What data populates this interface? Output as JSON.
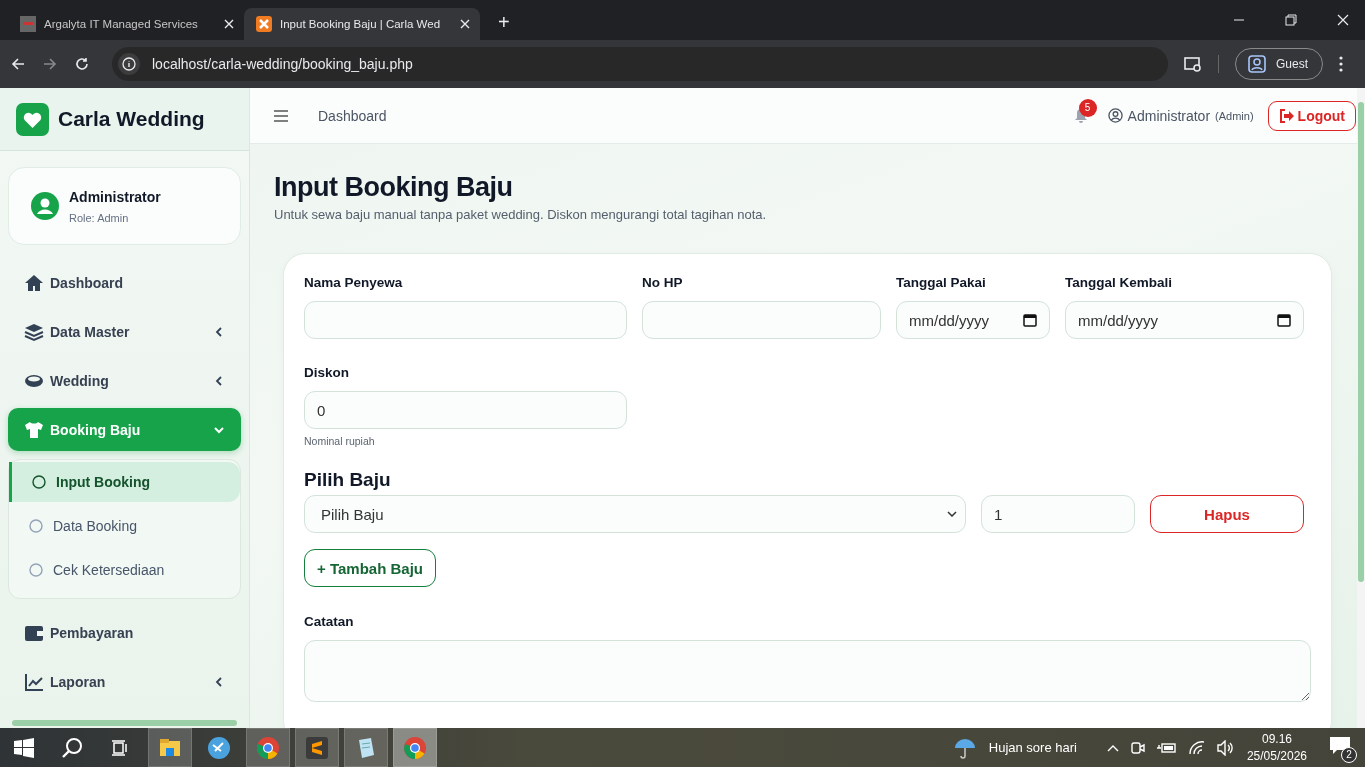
{
  "browser": {
    "tabs": [
      {
        "title": "Argalyta IT Managed Services",
        "selected": false
      },
      {
        "title": "Input Booking Baju | Carla Wed",
        "selected": true
      }
    ],
    "new_tab": "+",
    "address": "localhost/carla-wedding/booking_baju.php",
    "profile": "Guest"
  },
  "sidebar": {
    "brand": "Carla Wedding",
    "user": {
      "name": "Administrator",
      "role": "Role: Admin"
    },
    "menu": [
      {
        "label": "Dashboard",
        "selected": false
      },
      {
        "label": "Data Master",
        "expanded": false,
        "selected": false
      },
      {
        "label": "Wedding",
        "expanded": false,
        "selected": false
      },
      {
        "label": "Booking Baju",
        "expanded": true,
        "selected": true,
        "children": [
          {
            "label": "Input Booking",
            "selected": true
          },
          {
            "label": "Data Booking",
            "selected": false
          },
          {
            "label": "Cek Ketersediaan",
            "selected": false
          }
        ]
      },
      {
        "label": "Pembayaran",
        "selected": false
      },
      {
        "label": "Laporan",
        "expanded": false,
        "selected": false
      }
    ]
  },
  "topbar": {
    "breadcrumb": "Dashboard",
    "notifications": "5",
    "user": "Administrator",
    "role": "(Admin)",
    "logout": "Logout"
  },
  "page": {
    "title": "Input Booking Baju",
    "subtitle": "Untuk sewa baju manual tanpa paket wedding. Diskon mengurangi total tagihan nota."
  },
  "form": {
    "fields": [
      {
        "label": "Nama Penyewa",
        "kind": "text"
      },
      {
        "label": "No HP",
        "kind": "text"
      },
      {
        "label": "Tanggal Pakai",
        "kind": "date",
        "placeholder": "mm/dd/yyyy"
      },
      {
        "label": "Tanggal Kembali",
        "kind": "date",
        "placeholder": "mm/dd/yyyy"
      },
      {
        "label": "Diskon",
        "kind": "text",
        "value": "0",
        "hint": "Nominal rupiah"
      }
    ],
    "items_title": "Pilih Baju",
    "items": [
      {
        "baju": "Pilih Baju",
        "qty": "1",
        "remove": "Hapus"
      }
    ],
    "add_button": "+ Tambah Baju",
    "notes_label": "Catatan"
  },
  "taskbar": {
    "apps": [
      {
        "running": true,
        "selected": false
      },
      {
        "running": false,
        "selected": false
      },
      {
        "running": true,
        "selected": false
      },
      {
        "running": true,
        "selected": false
      },
      {
        "running": true,
        "selected": false
      },
      {
        "running": true,
        "selected": true
      }
    ],
    "weather": "Hujan sore hari",
    "time": "09.16",
    "date": "25/05/2026",
    "notifications": "2"
  }
}
